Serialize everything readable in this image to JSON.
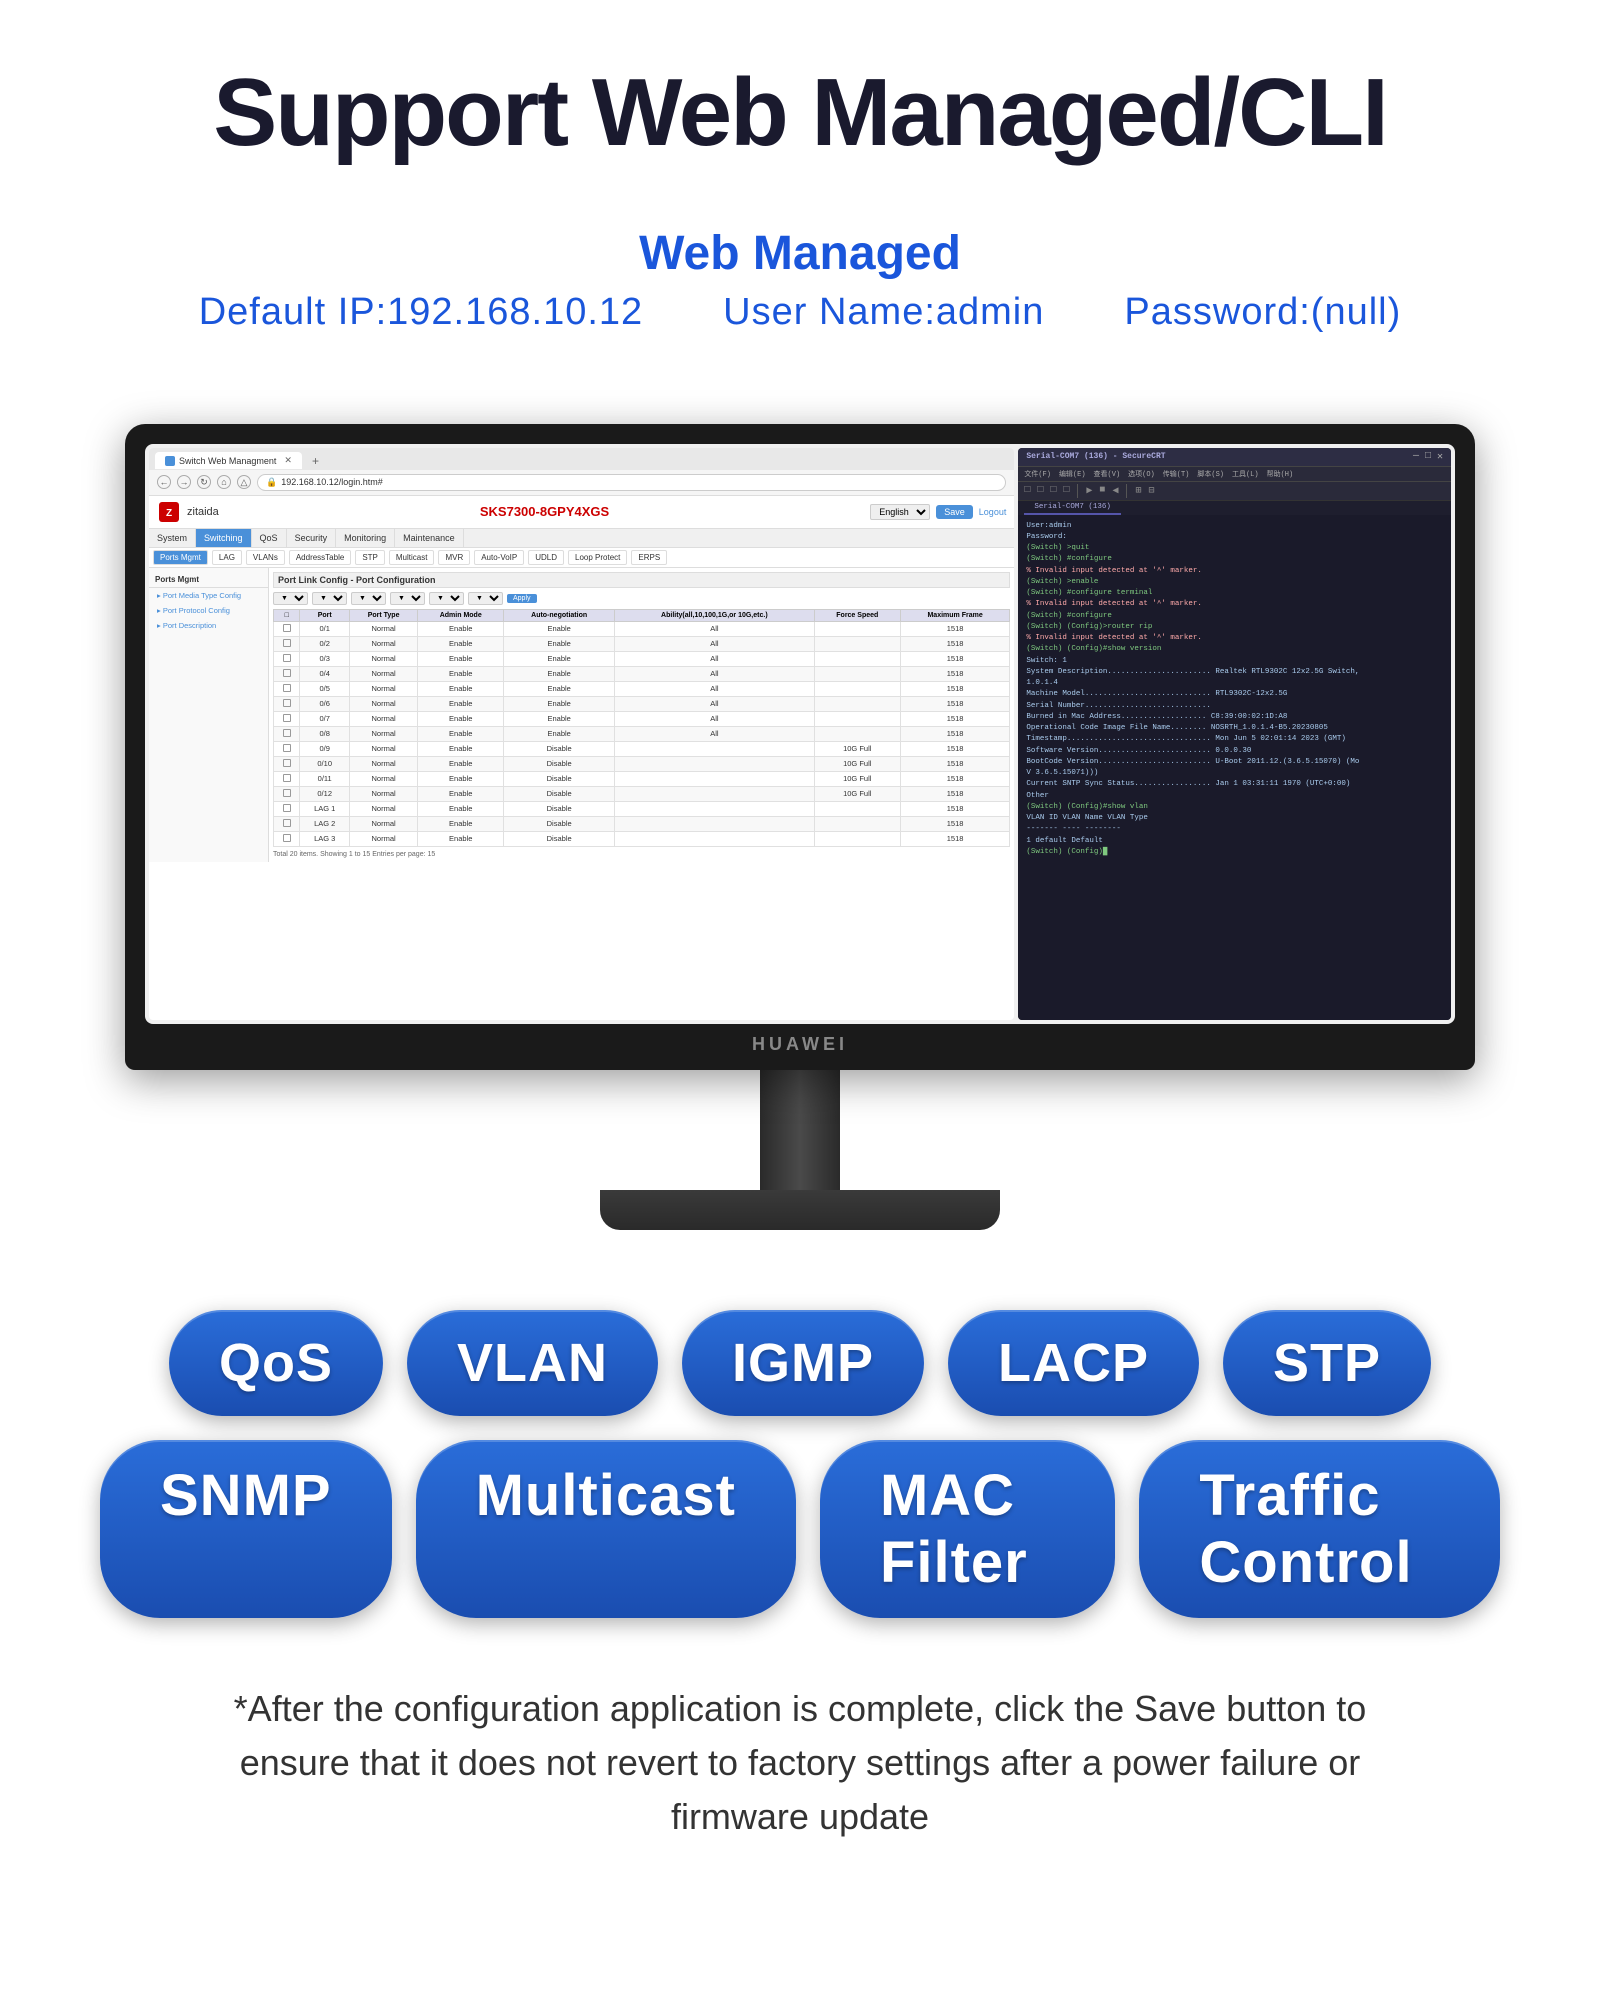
{
  "header": {
    "main_title": "Support Web Managed/CLI",
    "section_label": "Web Managed",
    "default_ip_label": "Default IP:192.168.10.12",
    "username_label": "User Name:admin",
    "password_label": "Password:(null)"
  },
  "browser": {
    "tab_label": "Switch Web Managment",
    "address": "192.168.10.12/login.htm#",
    "nav_btns": [
      "←",
      "→",
      "⟳",
      "🏠",
      "△"
    ]
  },
  "switch_ui": {
    "model": "SKS7300-8GPY4XGS",
    "logo_text": "zitaida",
    "language": "English",
    "save_label": "Save",
    "logout_label": "Logout",
    "nav_items": [
      "System",
      "Switching",
      "QoS",
      "Security",
      "Monitoring",
      "Maintenance"
    ],
    "active_nav": "Switching",
    "sub_nav_items": [
      "Ports Mgmt",
      "LAG",
      "VLANs",
      "AddressTable",
      "STP",
      "Multicast",
      "MVR",
      "Auto-VoIP",
      "UDLD",
      "Loop Protect",
      "ERPS"
    ],
    "active_sub": "Ports Mgmt",
    "sidebar_title": "Ports Mgmt",
    "sidebar_items": [
      "Port Media Type Config",
      "Port Protocol Config",
      "Port Description"
    ],
    "section_heading": "Port Link Config - Port Configuration",
    "filter_row": {
      "port_label": "Port",
      "port_type_label": "Port Type",
      "admin_mode_label": "Admin Mode",
      "auto_neg_label": "Auto-negotiation",
      "ability_label": "Ability(all,10,100,1G,or 10G,etc.)",
      "force_speed_label": "Force Speed",
      "max_frame_label": "Maximum Frame"
    },
    "table_headers": [
      "",
      "Port",
      "Port Type",
      "Admin Mode",
      "Auto-negotiation",
      "Ability(all,10,100,1G,or 10G,etc.)",
      "Force Speed",
      "Maximum Frame"
    ],
    "table_rows": [
      {
        "port": "0/1",
        "type": "Normal",
        "admin": "Enable",
        "auto_neg": "Enable",
        "ability": "All",
        "force": "",
        "max_frame": "1518"
      },
      {
        "port": "0/2",
        "type": "Normal",
        "admin": "Enable",
        "auto_neg": "Enable",
        "ability": "All",
        "force": "",
        "max_frame": "1518"
      },
      {
        "port": "0/3",
        "type": "Normal",
        "admin": "Enable",
        "auto_neg": "Enable",
        "ability": "All",
        "force": "",
        "max_frame": "1518"
      },
      {
        "port": "0/4",
        "type": "Normal",
        "admin": "Enable",
        "auto_neg": "Enable",
        "ability": "All",
        "force": "",
        "max_frame": "1518"
      },
      {
        "port": "0/5",
        "type": "Normal",
        "admin": "Enable",
        "auto_neg": "Enable",
        "ability": "All",
        "force": "",
        "max_frame": "1518"
      },
      {
        "port": "0/6",
        "type": "Normal",
        "admin": "Enable",
        "auto_neg": "Enable",
        "ability": "All",
        "force": "",
        "max_frame": "1518"
      },
      {
        "port": "0/7",
        "type": "Normal",
        "admin": "Enable",
        "auto_neg": "Enable",
        "ability": "All",
        "force": "",
        "max_frame": "1518"
      },
      {
        "port": "0/8",
        "type": "Normal",
        "admin": "Enable",
        "auto_neg": "Enable",
        "ability": "All",
        "force": "",
        "max_frame": "1518"
      },
      {
        "port": "0/9",
        "type": "Normal",
        "admin": "Enable",
        "auto_neg": "Disable",
        "ability": "",
        "force": "10G Full",
        "max_frame": "1518"
      },
      {
        "port": "0/10",
        "type": "Normal",
        "admin": "Enable",
        "auto_neg": "Disable",
        "ability": "",
        "force": "10G Full",
        "max_frame": "1518"
      },
      {
        "port": "0/11",
        "type": "Normal",
        "admin": "Enable",
        "auto_neg": "Disable",
        "ability": "",
        "force": "10G Full",
        "max_frame": "1518"
      },
      {
        "port": "0/12",
        "type": "Normal",
        "admin": "Enable",
        "auto_neg": "Disable",
        "ability": "",
        "force": "10G Full",
        "max_frame": "1518"
      },
      {
        "port": "LAG 1",
        "type": "Normal",
        "admin": "Enable",
        "auto_neg": "Disable",
        "ability": "",
        "force": "",
        "max_frame": "1518"
      },
      {
        "port": "LAG 2",
        "type": "Normal",
        "admin": "Enable",
        "auto_neg": "Disable",
        "ability": "",
        "force": "",
        "max_frame": "1518"
      },
      {
        "port": "LAG 3",
        "type": "Normal",
        "admin": "Enable",
        "auto_neg": "Disable",
        "ability": "",
        "force": "",
        "max_frame": "1518"
      }
    ],
    "table_footer": "Total 20 items. Showing 1 to 15  Entries per page: 15"
  },
  "cli": {
    "window_title": "Serial-COM7 (136) - SecureCRT",
    "menu_items": [
      "文件(F)",
      "编辑(E)",
      "查看(V)",
      "选项(O)",
      "传输(T)",
      "脚本(S)",
      "工具(L)",
      "帮助(H)"
    ],
    "tab_label": "Serial-COM7 (136)",
    "lines": [
      {
        "type": "info",
        "text": "User:admin"
      },
      {
        "type": "info",
        "text": "Password:"
      },
      {
        "type": "prompt",
        "text": "(Switch) >quit"
      },
      {
        "type": "prompt",
        "text": "(Switch) #configure"
      },
      {
        "type": "error",
        "text": "% Invalid input detected at '^' marker."
      },
      {
        "type": "prompt",
        "text": "(Switch) >enable"
      },
      {
        "type": "prompt",
        "text": "(Switch) #configure terminal"
      },
      {
        "type": "error",
        "text": "% Invalid input detected at '^' marker."
      },
      {
        "type": "prompt",
        "text": "(Switch) #configure"
      },
      {
        "type": "prompt",
        "text": "(Switch) (Config)>router rip"
      },
      {
        "type": "error",
        "text": "% Invalid input detected at '^' marker."
      },
      {
        "type": "prompt",
        "text": "(Switch) (Config)#show version"
      },
      {
        "type": "info",
        "text": "Switch: 1"
      },
      {
        "type": "info",
        "text": "System Description....................... Realtek RTL9302C 12x2.5G Switch,"
      },
      {
        "type": "info",
        "text": "                                          1.0.1.4"
      },
      {
        "type": "info",
        "text": "Machine Model............................ RTL9302C-12x2.5G"
      },
      {
        "type": "info",
        "text": "Serial Number............................ "
      },
      {
        "type": "info",
        "text": "Burned in Mac Address................... C8:39:00:02:1D:A8"
      },
      {
        "type": "info",
        "text": "Operational Code Image File Name........ NOSRTH_1.0.1.4-B5.20230805"
      },
      {
        "type": "info",
        "text": "Timestamp................................ Mon Jun  5 02:01:14 2023 (GMT)"
      },
      {
        "type": "info",
        "text": "Software Version......................... 0.0.0.30"
      },
      {
        "type": "info",
        "text": "BootCode Version......................... U-Boot 2011.12.(3.6.5.15070) (Mo"
      },
      {
        "type": "info",
        "text": "V 3.6.5.15071)))"
      },
      {
        "type": "info",
        "text": "Current SNTP Sync Status................. Jan  1 03:31:11 1970 (UTC+0:00)"
      },
      {
        "type": "info",
        "text": "                                          Other"
      },
      {
        "type": "prompt",
        "text": "(Switch) (Config)#show vlan"
      },
      {
        "type": "info",
        "text": "VLAN ID VLAN Name                    VLAN Type"
      },
      {
        "type": "info",
        "text": "------- ----                         --------"
      },
      {
        "type": "info",
        "text": "1       default                      Default"
      },
      {
        "type": "prompt",
        "text": "(Switch) (Config)█"
      }
    ]
  },
  "badges": {
    "row1": [
      "QoS",
      "VLAN",
      "IGMP",
      "LACP",
      "STP"
    ],
    "row2": [
      "SNMP",
      "Multicast",
      "MAC Filter",
      "Traffic Control"
    ]
  },
  "footer": {
    "note": "*After the configuration application is complete, click the Save button to ensure that it does not revert to factory settings after a power failure or firmware update"
  }
}
